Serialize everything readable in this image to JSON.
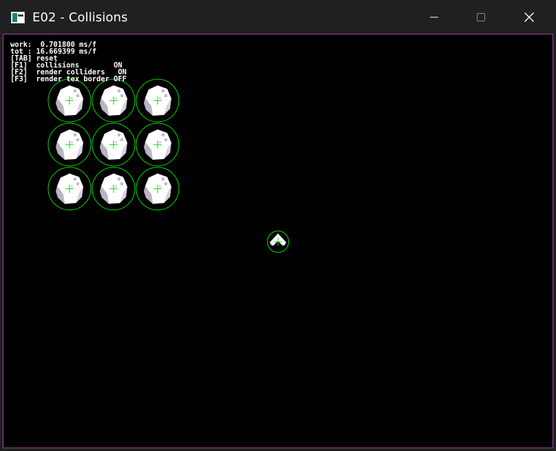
{
  "window": {
    "title": "E02 - Collisions",
    "app_icon": "app-window-icon",
    "controls": [
      "minimize-icon",
      "maximize-icon",
      "close-icon"
    ]
  },
  "hud": {
    "work": "work:  0.701800 ms/f",
    "tot": "tot : 16.669399 ms/f",
    "reset": "[TAB] reset",
    "collisions": "[F1]  collisions        ON",
    "render_colliders": "[F2]  render colliders   ON",
    "render_tex_border": "[F3]  render tex border OFF"
  },
  "scene": {
    "background": "#000000",
    "collider_color": "#00dd00",
    "asteroid_color": "#ffffff",
    "asteroid_count": 9,
    "ship_count": 1
  },
  "colors": {
    "titlebar": "#202020",
    "frame_border": "#a040a8"
  }
}
